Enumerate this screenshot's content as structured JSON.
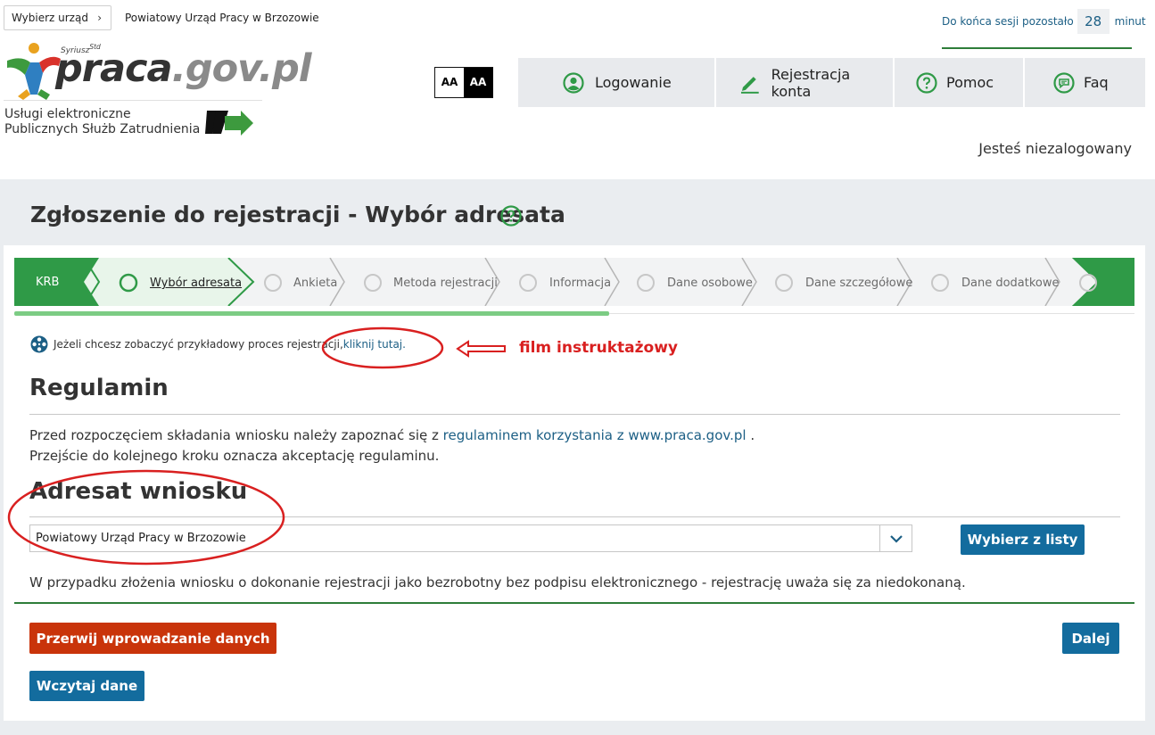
{
  "header": {
    "select_office_label": "Wybierz urząd",
    "office_name": "Powiatowy Urząd Pracy w Brzozowie",
    "session_label": "Do końca sesji pozostało",
    "session_minutes": "28",
    "session_unit": "minut"
  },
  "logo": {
    "brand_main": "praca",
    "brand_domain": ".gov.pl",
    "brand_super": "Syriusz",
    "brand_super_sup": "Std",
    "services_line1": "Usługi elektroniczne",
    "services_line2": "Publicznych Służb Zatrudnienia"
  },
  "contrast": {
    "normal": "AA",
    "high": "AA"
  },
  "nav": {
    "login": "Logowanie",
    "register": "Rejestracja konta",
    "help": "Pomoc",
    "faq": "Faq"
  },
  "user_status": "Jesteś niezalogowany",
  "page_title": "Zgłoszenie do rejestracji - Wybór adresata",
  "stepper": {
    "first": "KRB",
    "steps": [
      "Wybór adresata",
      "Ankieta",
      "Metoda rejestracji",
      "Informacja",
      "Dane osobowe",
      "Dane szczegółowe",
      "Dane dodatkowe"
    ],
    "active_index": 0
  },
  "film": {
    "text": "Jeżeli chcesz zobaczyć przykładowy proces rejestracji, ",
    "link": "kliknij tutaj",
    "after": ".",
    "annotation": "film instruktażowy"
  },
  "regulamin": {
    "heading": "Regulamin",
    "line1_pre": "Przed rozpoczęciem składania wniosku należy zapoznać się z ",
    "line1_link": "regulaminem korzystania z www.praca.gov.pl",
    "line1_post": " .",
    "line2": "Przejście do kolejnego kroku oznacza akceptację regulaminu."
  },
  "adresat": {
    "heading": "Adresat wniosku",
    "selected": "Powiatowy Urząd Pracy w Brzozowie",
    "choose_button": "Wybierz z listy"
  },
  "notice": "W przypadku złożenia wniosku o dokonanie rejestracji jako bezrobotny bez podpisu elektronicznego - rejestrację uważa się za niedokonaną.",
  "buttons": {
    "abort": "Przerwij wprowadzanie danych",
    "next": "Dalej",
    "load": "Wczytaj dane"
  },
  "colors": {
    "primary": "#136c9e",
    "danger": "#c9340a",
    "green": "#2f9a47",
    "annotation": "#d92020"
  }
}
